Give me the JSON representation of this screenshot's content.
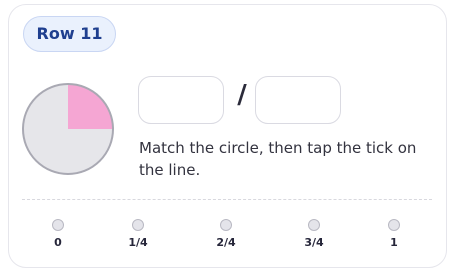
{
  "row_badge": "Row 11",
  "fraction": {
    "numerator": "",
    "denominator": "",
    "slash": "/"
  },
  "circle": {
    "shaded_fraction": 0.25,
    "fill_color": "#f5a6d3",
    "base_color": "#e6e6ea",
    "outline_color": "#a9a9b3"
  },
  "instruction": "Match the circle, then tap the tick on the line.",
  "number_line": {
    "ticks": [
      "0",
      "1/4",
      "2/4",
      "3/4",
      "1"
    ]
  }
}
